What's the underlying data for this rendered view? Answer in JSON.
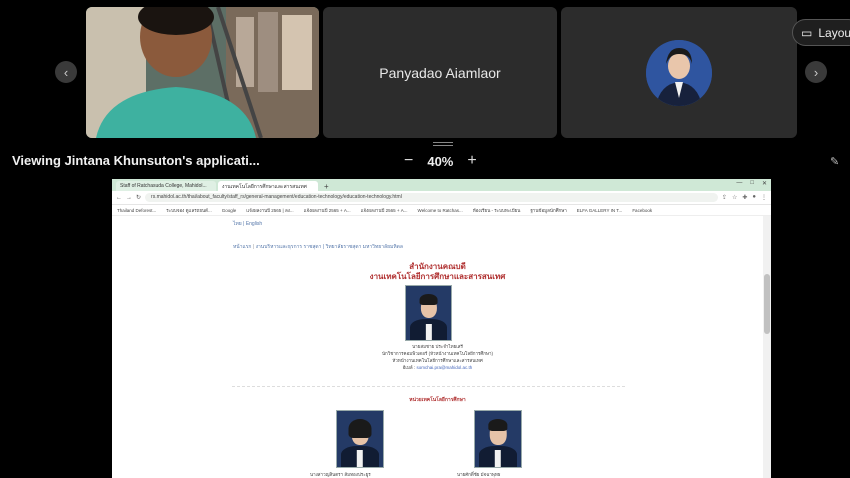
{
  "meeting": {
    "participants": [
      {
        "name": "",
        "type": "video"
      },
      {
        "name": "Panyadao Aiamlaor",
        "type": "name"
      },
      {
        "name": "",
        "type": "avatar"
      }
    ],
    "layout_label": "Layout",
    "viewing_label": "Viewing Jintana Khunsuton's applicati...",
    "zoom": {
      "minus": "−",
      "percent": "40%",
      "plus": "+"
    }
  },
  "browser": {
    "tabs": [
      {
        "title": "Staff of Ratchasuda College, Mahidol...",
        "active": false
      },
      {
        "title": "งานเทคโนโลยีการศึกษาและสารสนเทศ",
        "active": true
      }
    ],
    "url": "rs.mahidol.ac.th/thai/about_faculty/staff_rs/general-management/education-technology/education-technology.html",
    "bookmarks": [
      "Thailand Deforest...",
      "ระบบจอง ดูแลรถยนต์...",
      "Google",
      "แจ้งผลงานปี 2565 | ลง...",
      "แจ้งผลงานปี 2565 + A...",
      "แจ้งผลงานปี 2565 + A...",
      "Welcome to Ratchas...",
      "ห้องเรียน - ระบบทะเบียน",
      "ฐานข้อมูลนักศึกษา",
      "ELFA GALLERY IN T...",
      "Facebook"
    ]
  },
  "page": {
    "breadcrumb_top": "ไทย | English",
    "breadcrumb": {
      "home": "หน้าแรก",
      "sep": "|",
      "path": "งานบริหารและธุรการ ราชสุดา | วิทยาลัยราชสุดา มหาวิทยาลัยมหิดล"
    },
    "heading1": "สำนักงานคณบดี",
    "heading2": "งานเทคโนโลยีการศึกษาและสารสนเทศ",
    "head_person": {
      "name": "นายสมชาย ประจำไทยเสรี",
      "position": "นักวิชาการคอมพิวเตอร์ (หัวหน้างานเทคโนโลยีการศึกษา)",
      "role": "หัวหน้างานเทคโนโลยีการศึกษาและสารสนเทศ",
      "email_label": "อีเมล์ :",
      "email": "somchai.pra@mahidol.ac.th"
    },
    "section_title": "หน่วยเทคโนโลยีการศึกษา",
    "staff": [
      {
        "name": "นางสาวญสินตรา ส้มทองประยูร"
      },
      {
        "name": "นายศักดิ์ชัย มัจฉาพุทธ"
      }
    ]
  },
  "colors": {
    "background": "#000000",
    "tile": "#2c2c2c",
    "tab_strip": "#cfe8d6",
    "heading_red": "#b03030"
  }
}
